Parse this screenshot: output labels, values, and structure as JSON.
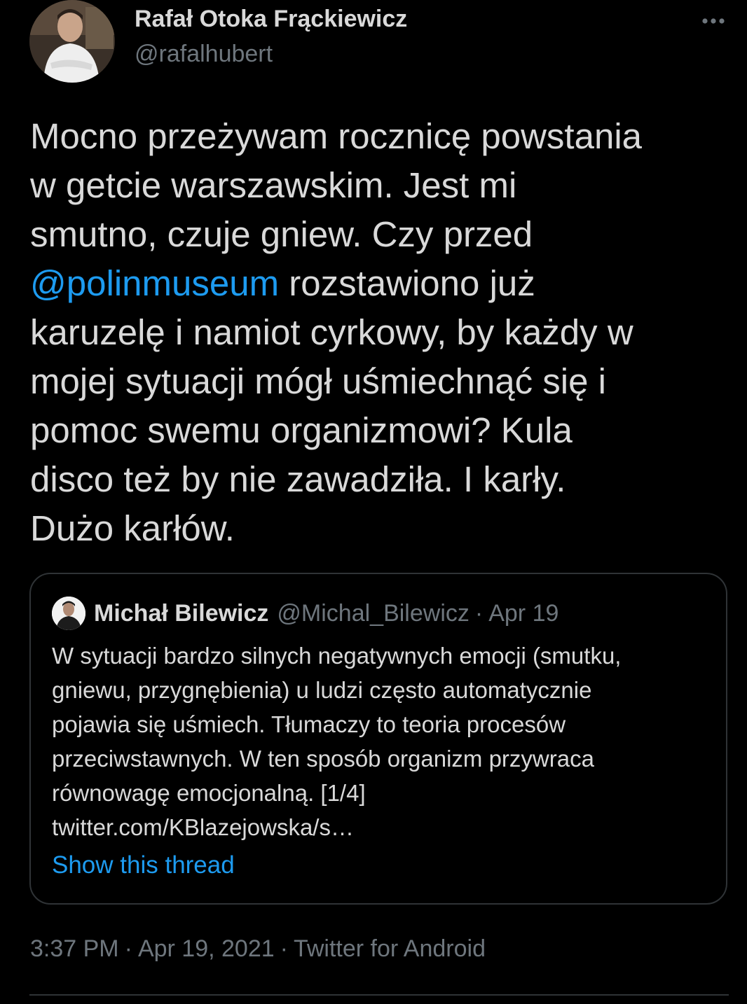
{
  "author": {
    "name": "Rafał Otoka Frąckiewicz",
    "handle": "@rafalhubert",
    "avatar_icon": "profile-photo"
  },
  "more_icon": "more-horizontal-icon",
  "tweet": {
    "lines": [
      "Mocno przeżywam rocznicę powstania",
      "w getcie warszawskim. Jest mi",
      "smutno, czuje gniew. Czy przed",
      " rozstawiono już",
      "karuzelę i namiot cyrkowy, by każdy w",
      "mojej sytuacji mógł uśmiechnąć się i",
      "pomoc swemu organizmowi? Kula",
      "disco też by nie zawadziła. I karły.",
      "Dużo karłów."
    ],
    "mention": "@polinmuseum"
  },
  "quote": {
    "name": "Michał Bilewicz",
    "handle": "@Michal_Bilewicz",
    "separator": "·",
    "date": "Apr 19",
    "lines": [
      "W sytuacji bardzo silnych negatywnych emocji (smutku,",
      "gniewu, przygnębienia) u ludzi często automatycznie",
      "pojawia się uśmiech. Tłumaczy to teoria procesów",
      "przeciwstawnych. W ten sposób organizm przywraca",
      "równowagę emocjonalną. [1/4]",
      "twitter.com/KBlazejowska/s…"
    ],
    "show_thread": "Show this thread"
  },
  "meta": {
    "time": "3:37 PM",
    "sep1": "·",
    "date": "Apr 19, 2021",
    "sep2": "·",
    "source": "Twitter for Android"
  },
  "colors": {
    "background": "#000000",
    "text": "#d9d9d9",
    "secondary": "#6e767d",
    "link": "#1d9bf0",
    "border": "#2f3336"
  }
}
